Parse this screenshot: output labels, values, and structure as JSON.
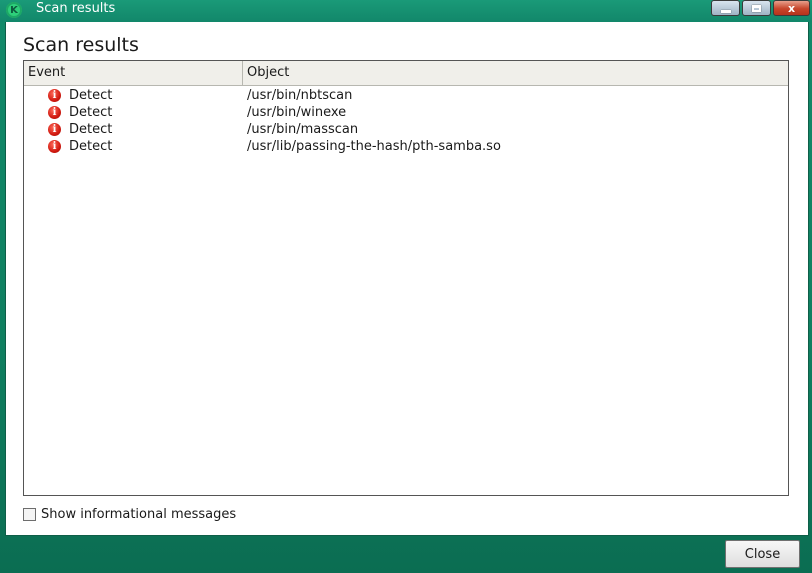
{
  "window": {
    "title": "Scan results",
    "logo_letter": "K",
    "close_glyph": "x"
  },
  "dialog": {
    "title": "Scan results"
  },
  "table": {
    "columns": [
      "Event",
      "Object"
    ],
    "rows": [
      {
        "icon": "error-icon",
        "event": "Detect",
        "object": "/usr/bin/nbtscan"
      },
      {
        "icon": "error-icon",
        "event": "Detect",
        "object": "/usr/bin/winexe"
      },
      {
        "icon": "error-icon",
        "event": "Detect",
        "object": "/usr/bin/masscan"
      },
      {
        "icon": "error-icon",
        "event": "Detect",
        "object": "/usr/lib/passing-the-hash/pth-samba.so"
      }
    ]
  },
  "options": {
    "show_informational_label": "Show informational messages",
    "show_informational_checked": false
  },
  "footer": {
    "close_label": "Close"
  },
  "colors": {
    "accent": "#12876a",
    "error": "#d11a10"
  }
}
